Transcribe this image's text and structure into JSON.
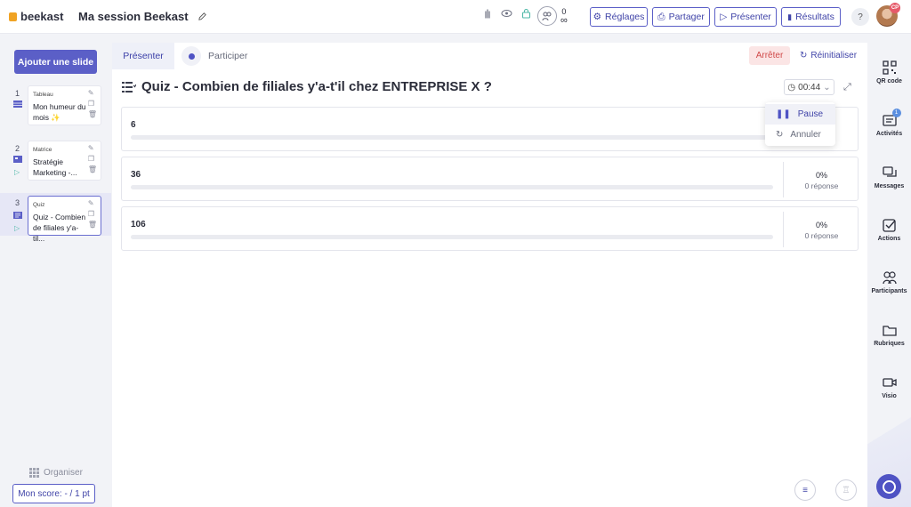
{
  "app": {
    "logo": "beekast",
    "session_title": "Ma session Beekast"
  },
  "header": {
    "counter": {
      "top": "0",
      "bottom": "∞"
    },
    "buttons": {
      "settings": "Réglages",
      "share": "Partager",
      "present": "Présenter",
      "results": "Résultats"
    },
    "help": "?",
    "avatar_initials": "CP"
  },
  "left": {
    "add_slide": "Ajouter une slide",
    "slides": [
      {
        "num": "1",
        "type": "Tableau",
        "name": "Mon humeur du mois ✨"
      },
      {
        "num": "2",
        "type": "Matrice",
        "name": "Stratégie Marketing -..."
      },
      {
        "num": "3",
        "type": "Quiz",
        "name": "Quiz - Combien de filiales y'a-til..."
      }
    ],
    "organise": "Organiser",
    "score": "Mon score: - / 1 pt"
  },
  "main": {
    "tabs": {
      "present": "Présenter",
      "participate": "Participer"
    },
    "stop": "Arrêter",
    "reset": "Réinitialiser",
    "question": "Quiz - Combien de filiales y'a-t'il chez ENTREPRISE X ?",
    "timer": "00:44",
    "answers": [
      {
        "label": "6",
        "percent": "",
        "responses": "",
        "fill": 0
      },
      {
        "label": "36",
        "percent": "0%",
        "responses": "0 réponse",
        "fill": 0
      },
      {
        "label": "106",
        "percent": "0%",
        "responses": "0 réponse",
        "fill": 0
      }
    ],
    "timer_menu": {
      "pause": "Pause",
      "cancel": "Annuler"
    }
  },
  "right": {
    "items": [
      {
        "label": "QR code"
      },
      {
        "label": "Activités",
        "badge": "1"
      },
      {
        "label": "Messages"
      },
      {
        "label": "Actions"
      },
      {
        "label": "Participants"
      },
      {
        "label": "Rubriques"
      },
      {
        "label": "Visio"
      }
    ]
  },
  "colors": {
    "accent": "#5b5fc7",
    "stop_bg": "#fbe5e5",
    "stop_text": "#d04a4a",
    "brand": "#f0a324"
  }
}
